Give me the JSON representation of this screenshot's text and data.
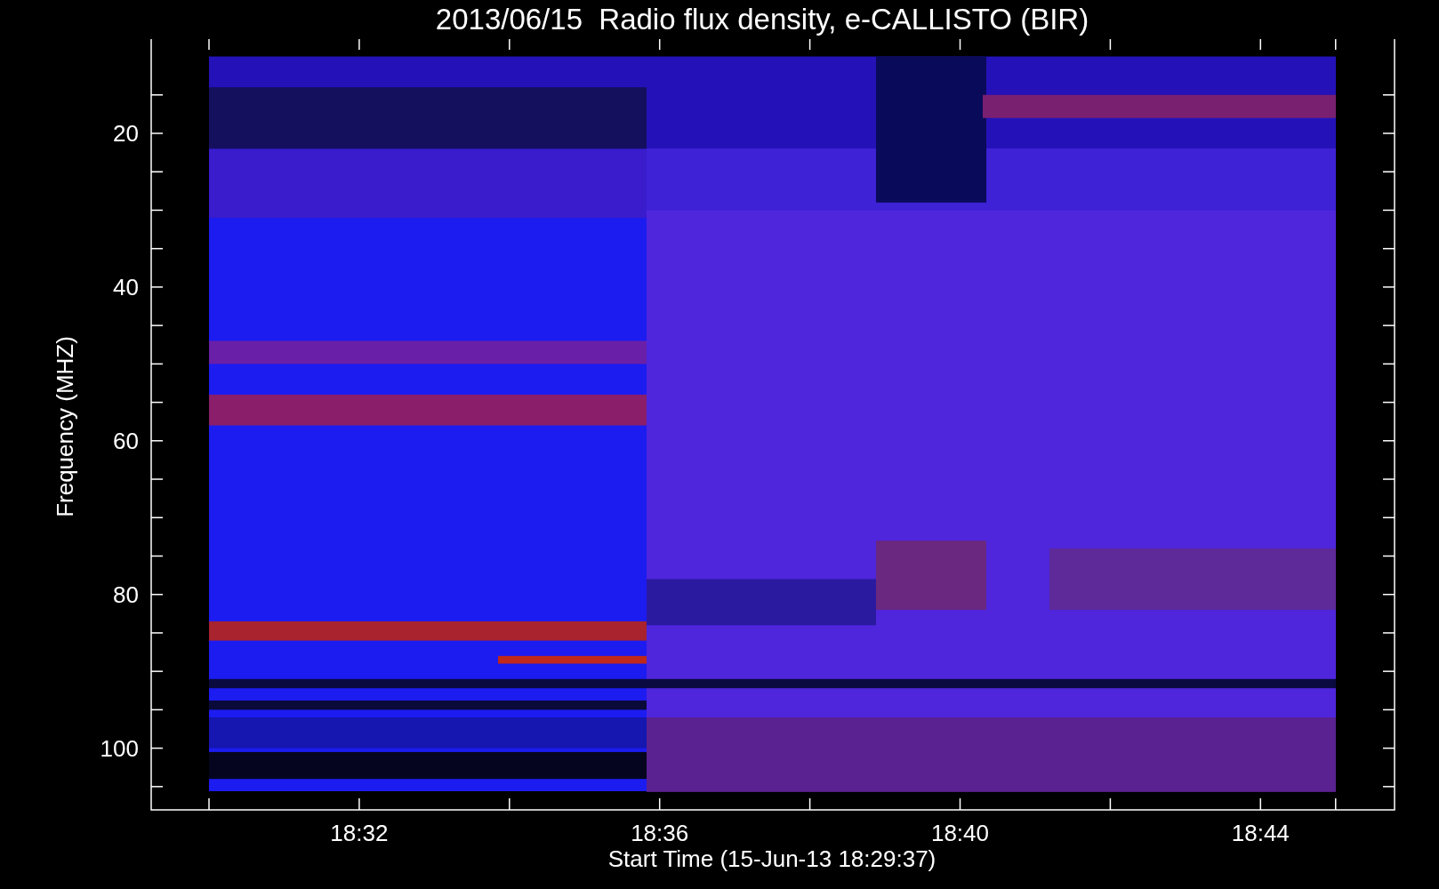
{
  "title": "2013/06/15  Radio flux density, e-CALLISTO (BIR)",
  "ylabel": "Frequency (MHZ)",
  "xlabel": "Start Time (15-Jun-13 18:29:37)",
  "yticks": [
    "20",
    "40",
    "60",
    "80",
    "100"
  ],
  "xticks": [
    "18:32",
    "18:36",
    "18:40",
    "18:44"
  ]
}
